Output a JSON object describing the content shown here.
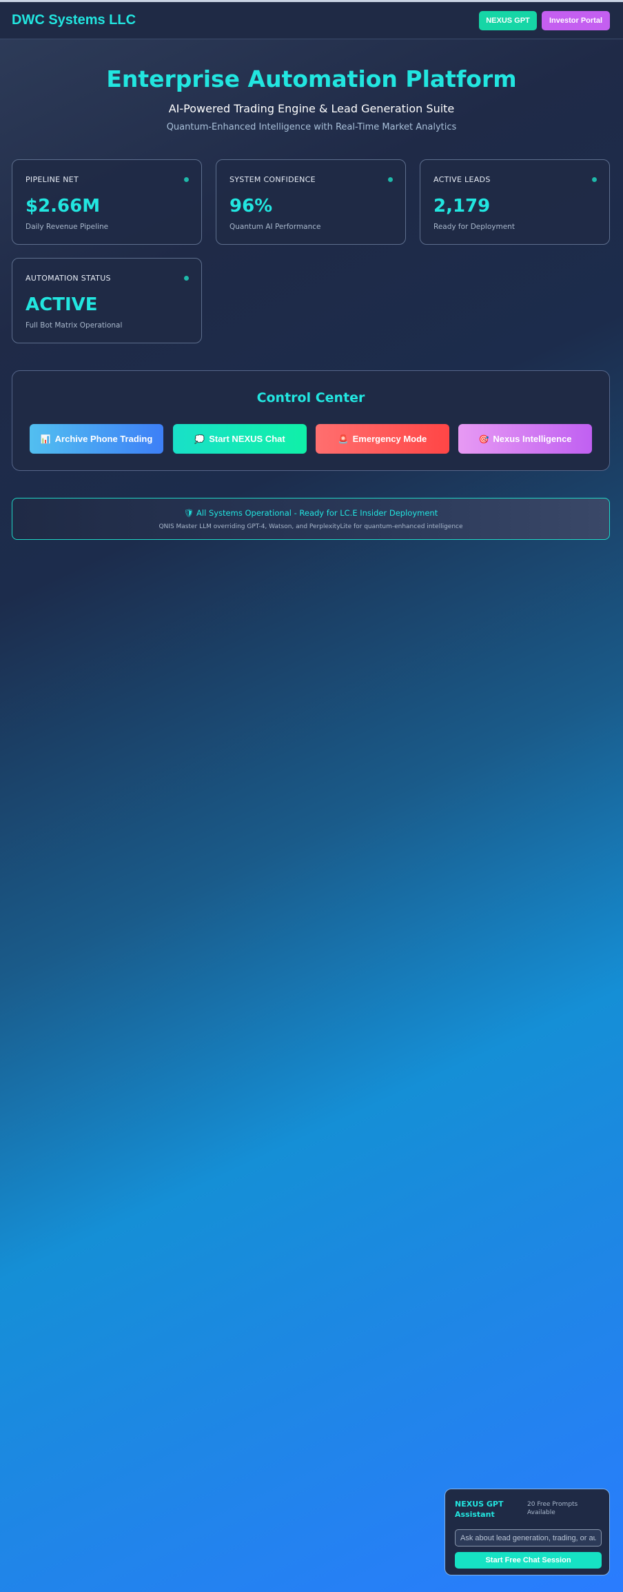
{
  "header": {
    "brand": "DWC Systems LLC",
    "nexus_gpt_label": "NEXUS GPT",
    "investor_portal_label": "Investor Portal"
  },
  "hero": {
    "title": "Enterprise Automation Platform",
    "subtitle": "AI-Powered Trading Engine & Lead Generation Suite",
    "tagline": "Quantum-Enhanced Intelligence with Real-Time Market Analytics"
  },
  "metrics": [
    {
      "label": "PIPELINE NET",
      "value": "$2.66M",
      "description": "Daily Revenue Pipeline"
    },
    {
      "label": "SYSTEM CONFIDENCE",
      "value": "96%",
      "description": "Quantum AI Performance"
    },
    {
      "label": "ACTIVE LEADS",
      "value": "2,179",
      "description": "Ready for Deployment"
    },
    {
      "label": "AUTOMATION STATUS",
      "value": "ACTIVE",
      "description": "Full Bot Matrix Operational"
    }
  ],
  "control_center": {
    "title": "Control Center",
    "buttons": [
      {
        "icon": "📊",
        "icon_name": "chart-icon",
        "label": "Archive Phone Trading"
      },
      {
        "icon": "💭",
        "icon_name": "chat-bubble-icon",
        "label": "Start NEXUS Chat"
      },
      {
        "icon": "🚨",
        "icon_name": "siren-icon",
        "label": "Emergency Mode"
      },
      {
        "icon": "🎯",
        "icon_name": "target-icon",
        "label": "Nexus Intelligence"
      }
    ]
  },
  "status_banner": {
    "icon": "🛡",
    "message": "All Systems Operational - Ready for LC.E Insider Deployment",
    "detail": "QNIS Master LLM overriding GPT-4, Watson, and PerplexityLite for quantum-enhanced intelligence"
  },
  "chat_widget": {
    "title": "NEXUS GPT Assistant",
    "prompts_info": "20 Free Prompts Available",
    "input_placeholder": "Ask about lead generation, trading, or automation...",
    "start_button_label": "Start Free Chat Session"
  },
  "colors": {
    "accent": "#22e6e0",
    "nexus_button": "#16d6a6",
    "investor_button": "#c45ff0"
  }
}
